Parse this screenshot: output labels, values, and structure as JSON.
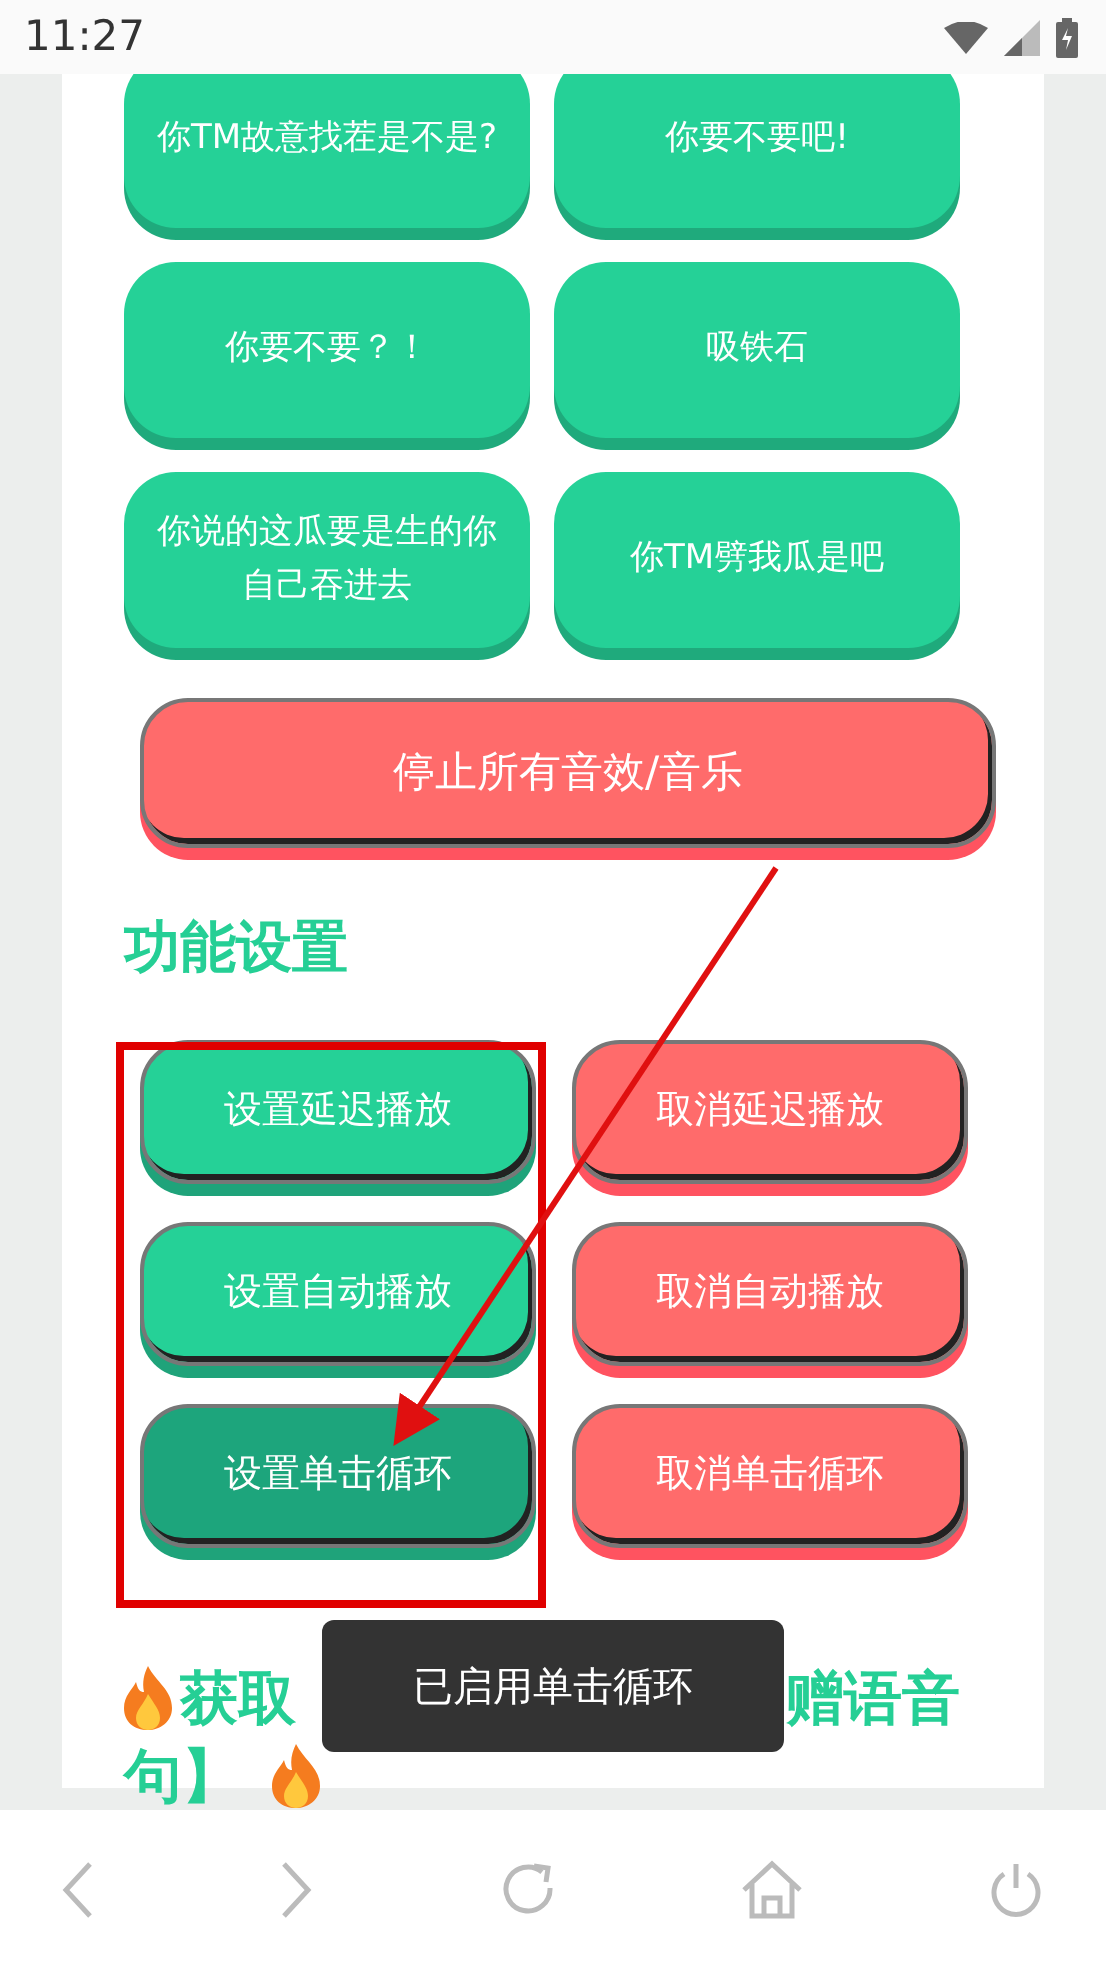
{
  "status_bar": {
    "time": "11:27"
  },
  "sound_buttons": [
    {
      "label": "你TM故意找茬是不是?"
    },
    {
      "label": "你要不要吧!"
    },
    {
      "label": "你要不要？！"
    },
    {
      "label": "吸铁石"
    },
    {
      "label": "你说的这瓜要是生的你自己吞进去"
    },
    {
      "label": "你TM劈我瓜是吧"
    }
  ],
  "stop_button": {
    "label": "停止所有音效/音乐"
  },
  "settings": {
    "title": "功能设置",
    "buttons": [
      {
        "label": "设置延迟播放",
        "kind": "set",
        "selected": false
      },
      {
        "label": "取消延迟播放",
        "kind": "cancel",
        "selected": false
      },
      {
        "label": "设置自动播放",
        "kind": "set",
        "selected": false
      },
      {
        "label": "取消自动播放",
        "kind": "cancel",
        "selected": false
      },
      {
        "label": "设置单击循环",
        "kind": "set",
        "selected": true
      },
      {
        "label": "取消单击循环",
        "kind": "cancel",
        "selected": false
      }
    ]
  },
  "next_heading": {
    "line_1_start": "获取",
    "line_1_end": "赠语音",
    "line_2": "句】"
  },
  "toast": {
    "text": "已启用单击循环"
  }
}
